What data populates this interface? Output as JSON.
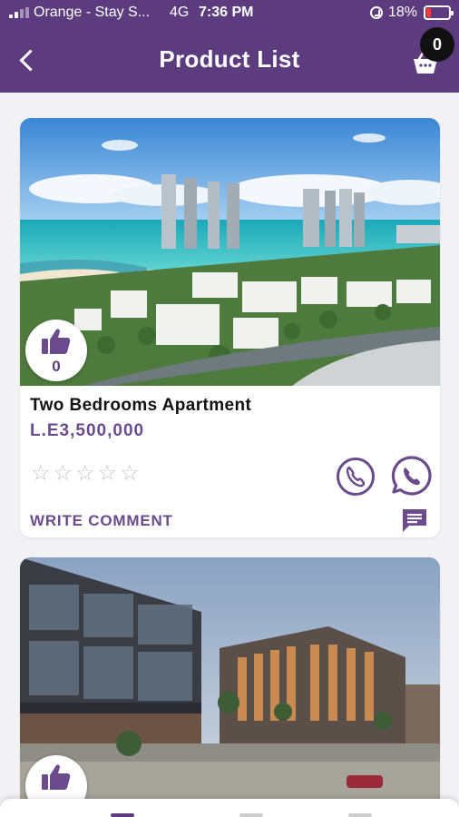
{
  "status_bar": {
    "carrier": "Orange - Stay S...",
    "network": "4G",
    "time": "7:36 PM",
    "battery": "18%"
  },
  "header": {
    "title": "Product List",
    "cart_count": "0",
    "icons": {
      "back": "back-arrow-icon",
      "cart": "basket-icon"
    }
  },
  "colors": {
    "brand": "#5c3c7e",
    "accent": "#6b4b8c",
    "star_empty": "#c5c5c5"
  },
  "products": [
    {
      "title": "Two Bedrooms Apartment",
      "price": "L.E3,500,000",
      "likes": "0",
      "rating": 0,
      "comment_label": "WRITE COMMENT",
      "image": "coastal towers with lagoon resort"
    },
    {
      "image": "modern office and commercial buildings"
    }
  ]
}
